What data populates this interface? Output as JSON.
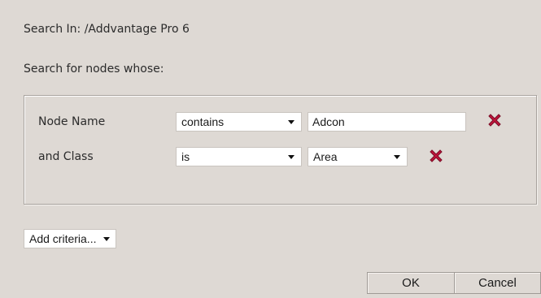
{
  "header": {
    "search_in": "Search In: /Addvantage Pro 6",
    "search_for": "Search for nodes whose:"
  },
  "criteria": [
    {
      "label": "Node Name",
      "operator": "contains",
      "value": "Adcon"
    },
    {
      "label": "and Class",
      "operator": "is",
      "value": "Area"
    }
  ],
  "add_criteria_label": "Add criteria...",
  "buttons": {
    "ok": "OK",
    "cancel": "Cancel"
  },
  "colors": {
    "background": "#ded9d4",
    "remove_icon": "#c0143c"
  },
  "icons": {
    "remove": "close-x-icon",
    "dropdown": "chevron-down-icon"
  }
}
